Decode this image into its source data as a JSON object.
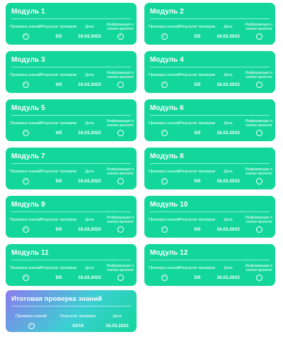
{
  "columns": {
    "knowledge_check": "Проверка знаний",
    "check_result": "Результат проверки",
    "date": "Дата",
    "project_info": "Информация о своем проекте"
  },
  "modules": [
    {
      "title": "Модуль 1",
      "knowledge_done": true,
      "result": "5/5",
      "date": "16.03.2023",
      "project_done": true
    },
    {
      "title": "Модуль 2",
      "knowledge_done": true,
      "result": "5/5",
      "date": "16.03.2023",
      "project_done": false
    },
    {
      "title": "Модуль 3",
      "knowledge_done": true,
      "result": "4/5",
      "date": "16.03.2023",
      "project_done": false
    },
    {
      "title": "Модуль 4",
      "knowledge_done": true,
      "result": "5/5",
      "date": "16.03.2023",
      "project_done": false
    },
    {
      "title": "Модуль 5",
      "knowledge_done": true,
      "result": "4/5",
      "date": "16.03.2023",
      "project_done": false
    },
    {
      "title": "Модуль 6",
      "knowledge_done": true,
      "result": "5/5",
      "date": "16.03.2023",
      "project_done": false
    },
    {
      "title": "Модуль 7",
      "knowledge_done": true,
      "result": "5/5",
      "date": "16.03.2023",
      "project_done": false
    },
    {
      "title": "Модуль 8",
      "knowledge_done": true,
      "result": "5/5",
      "date": "16.03.2023",
      "project_done": false
    },
    {
      "title": "Модуль 9",
      "knowledge_done": true,
      "result": "5/5",
      "date": "16.03.2023",
      "project_done": false
    },
    {
      "title": "Модуль 10",
      "knowledge_done": true,
      "result": "5/5",
      "date": "16.03.2023",
      "project_done": false
    },
    {
      "title": "Модуль 11",
      "knowledge_done": true,
      "result": "5/5",
      "date": "16.03.2023",
      "project_done": false
    },
    {
      "title": "Модуль 12",
      "knowledge_done": true,
      "result": "5/5",
      "date": "16.03.2023",
      "project_done": false
    }
  ],
  "final": {
    "title": "Итоговая проверка знаний",
    "knowledge_label": "Проверка знаний",
    "result_label": "Результат проверки",
    "date_label": "Дата",
    "knowledge_done": true,
    "result": "10/10",
    "date": "16.03.2023"
  },
  "icons": {
    "check": "check-circle-icon",
    "empty": "empty-circle-icon"
  },
  "colors": {
    "card": "#13d79a",
    "text": "#ffffff",
    "final_gradient_start": "#8b7bee",
    "final_gradient_end": "#13d79a"
  }
}
